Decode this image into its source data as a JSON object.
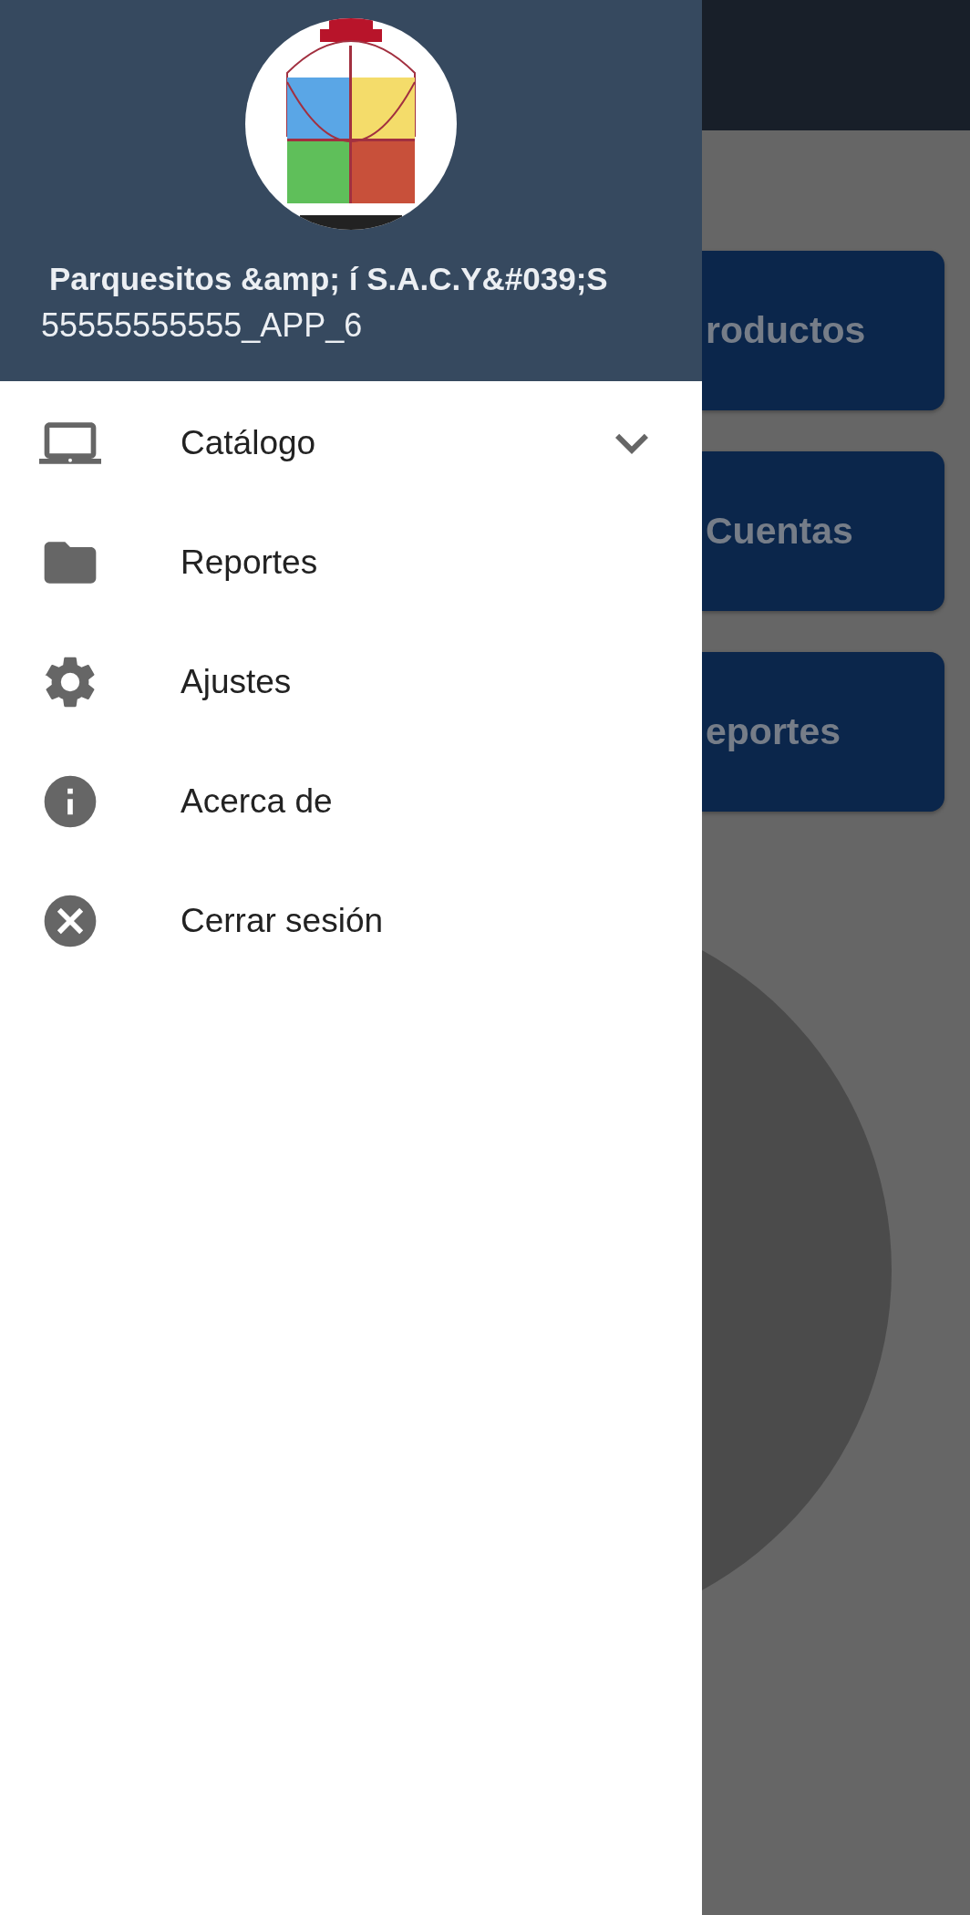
{
  "drawer": {
    "header": {
      "name": "Parquesitos &amp; í S.A.C.Y&#039;S",
      "account": "55555555555_APP_6"
    },
    "items": [
      {
        "label": "Catálogo",
        "expandable": true,
        "expanded": false
      },
      {
        "label": "Reportes",
        "expandable": false
      },
      {
        "label": "Ajustes",
        "expandable": false
      },
      {
        "label": "Acerca de",
        "expandable": false
      },
      {
        "label": "Cerrar sesión",
        "expandable": false
      }
    ]
  },
  "background": {
    "cards": [
      "roductos",
      "Cuentas",
      "eportes"
    ]
  }
}
